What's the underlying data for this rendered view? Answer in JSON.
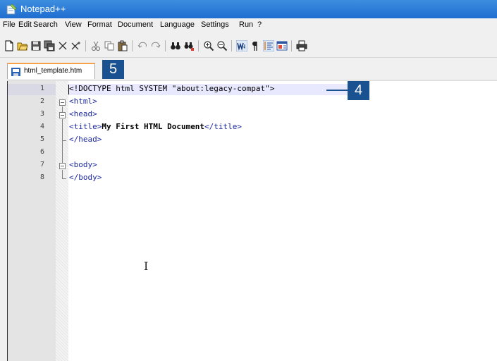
{
  "window": {
    "title": "Notepad++"
  },
  "menu": [
    "File",
    "Edit",
    "Search",
    "View",
    "Format",
    "Document",
    "Language",
    "Settings",
    "Run",
    "?"
  ],
  "tab": {
    "label": "html_template.htm"
  },
  "editor": {
    "line_numbers": [
      "1",
      "2",
      "3",
      "4",
      "5",
      "6",
      "7",
      "8"
    ],
    "lines": {
      "l1": "<!DOCTYPE html SYSTEM \"about:legacy-compat\">",
      "l2": "<html>",
      "l3": "<head>",
      "l4_open": "<title>",
      "l4_text": "My First HTML Document",
      "l4_close": "</title>",
      "l5": "</head>",
      "l6": "",
      "l7": "<body>",
      "l8": "</body>"
    }
  },
  "callouts": {
    "tab_callout": "5",
    "line_callout": "4"
  },
  "colors": {
    "title_bar": "#1f6ed0",
    "callout": "#1a5190",
    "tag": "#1e2b9e",
    "tab_highlight": "#f7a14a",
    "current_line": "#e8e8ff"
  }
}
